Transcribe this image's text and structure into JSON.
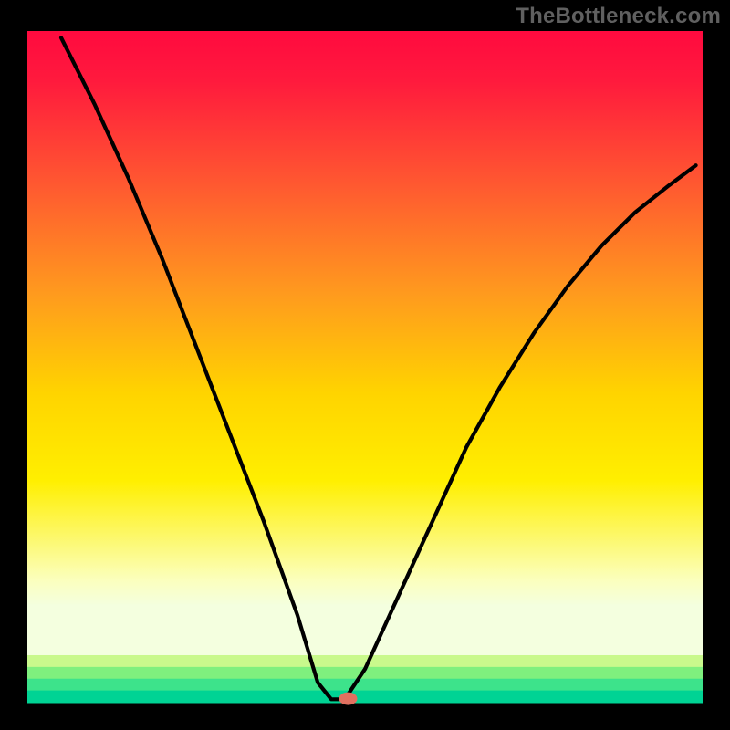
{
  "watermark": "TheBottleneck.com",
  "chart_data": {
    "type": "line",
    "title": "",
    "xlabel": "",
    "ylabel": "",
    "xlim": [
      0,
      100
    ],
    "ylim": [
      0,
      100
    ],
    "gradient_band": {
      "top_color": "#ff0a3f",
      "mid_color": "#ffec00",
      "low_color": "#f9ffe0",
      "stripes_colors": [
        "#c9f98c",
        "#7ff07e",
        "#3de38b",
        "#00d394"
      ],
      "bottom_color": "#00d394"
    },
    "curve": {
      "description": "V-shaped performance/bottleneck curve: starts at top-left, dips to near-zero minimum around x≈45, rises again toward right",
      "minimum_x": 45,
      "points": [
        {
          "x": 5,
          "y": 99
        },
        {
          "x": 10,
          "y": 89
        },
        {
          "x": 15,
          "y": 78
        },
        {
          "x": 20,
          "y": 66
        },
        {
          "x": 25,
          "y": 53
        },
        {
          "x": 30,
          "y": 40
        },
        {
          "x": 35,
          "y": 27
        },
        {
          "x": 40,
          "y": 13
        },
        {
          "x": 43,
          "y": 3
        },
        {
          "x": 45,
          "y": 0.5
        },
        {
          "x": 47,
          "y": 0.5
        },
        {
          "x": 50,
          "y": 5
        },
        {
          "x": 55,
          "y": 16
        },
        {
          "x": 60,
          "y": 27
        },
        {
          "x": 65,
          "y": 38
        },
        {
          "x": 70,
          "y": 47
        },
        {
          "x": 75,
          "y": 55
        },
        {
          "x": 80,
          "y": 62
        },
        {
          "x": 85,
          "y": 68
        },
        {
          "x": 90,
          "y": 73
        },
        {
          "x": 95,
          "y": 77
        },
        {
          "x": 99,
          "y": 80
        }
      ]
    },
    "marker": {
      "x": 47.5,
      "y": 0.6,
      "color": "#e07060"
    }
  }
}
